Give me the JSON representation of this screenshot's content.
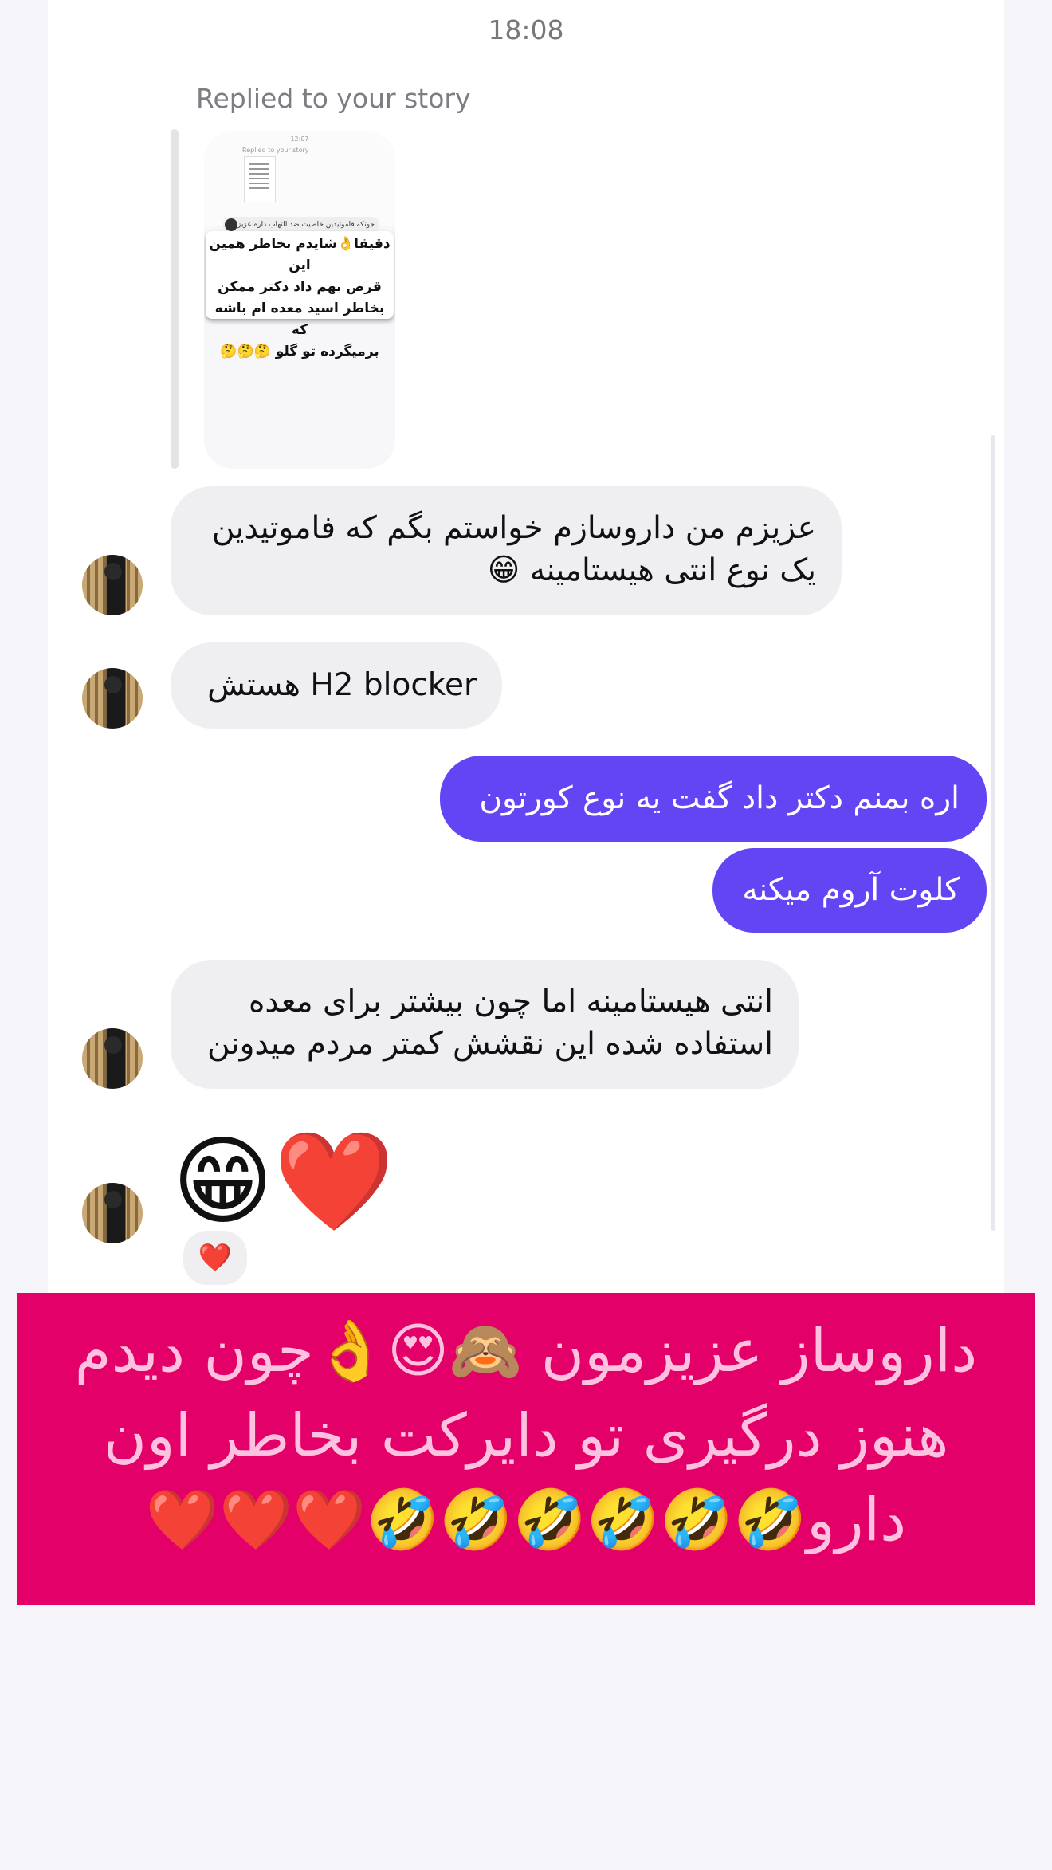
{
  "header": {
    "time": "18:08"
  },
  "story_reply": {
    "label": "Replied to your story",
    "story_time": "12:07",
    "story_replied_label": "Replied to your story",
    "story_sub": "جونکه فاموتیدین خاصیت ضد التهاب داره عزیزم",
    "story_text_lines": [
      "دقیقا👌شایدم بخاطر همین این",
      "قرص بهم داد دکتر ممکن",
      "بخاطر اسید معده ام باشه که",
      "برمیگرده تو گلو 🤔🤔🤔"
    ]
  },
  "messages": {
    "m1_line1": "عزیزم من داروسازم خواستم بگم که فاموتیدین",
    "m1_line2": "یک نوع انتی هیستامینه 😁",
    "m2": "H2 blocker هستش",
    "m3": "اره بمنم دکتر داد گفت یه نوع کورتون",
    "m4": "کلوت آروم میکنه",
    "m5_line1": "انتی هیستامینه اما چون بیشتر برای معده",
    "m5_line2": "استفاده شده این نقشش کمتر مردم میدونن",
    "m6_emoji": "😁❤️",
    "m6_reaction": "❤️"
  },
  "banner": {
    "line1": "داروساز عزیزمون 🙈😍👌چون دیدم",
    "line2": "هنوز درگیری تو دایرکت بخاطر اون",
    "line3": "دارو🤣🤣🤣🤣🤣🤣❤️❤️❤️"
  },
  "colors": {
    "outgoing_bubble": "#6445f3",
    "incoming_bubble": "#efeff2",
    "banner_bg": "#e30068",
    "banner_text": "#ffc1e0"
  }
}
